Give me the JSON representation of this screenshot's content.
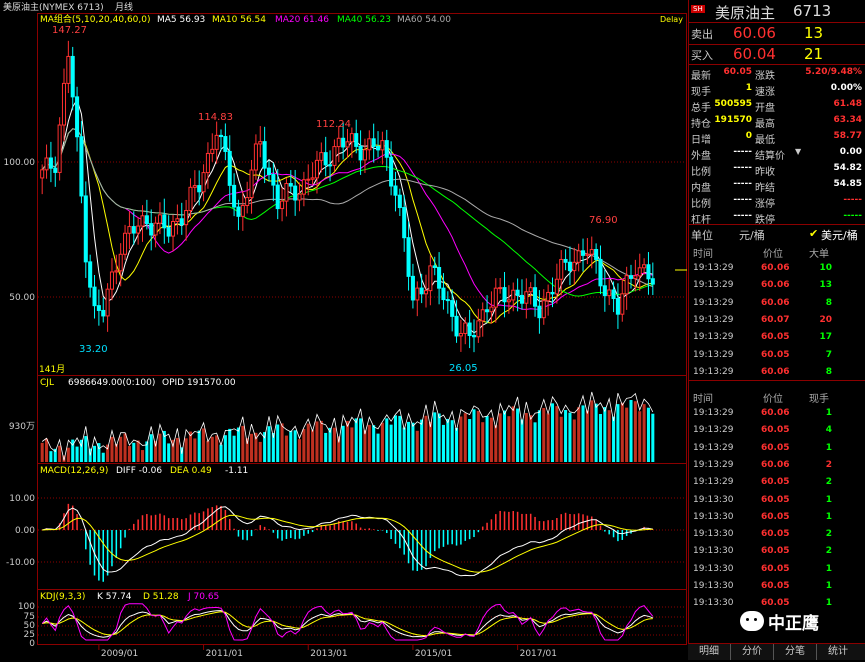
{
  "window": {
    "title": "美原油主(NYMEX 6713)",
    "period": "月线",
    "delay_label": "Delay"
  },
  "main_legend": {
    "group": "MA组合(5,10,20,40,60,0)",
    "items": [
      {
        "label": "MA5 56.93",
        "color": "#ffffff"
      },
      {
        "label": "MA10 56.54",
        "color": "#ffff00"
      },
      {
        "label": "MA20 61.46",
        "color": "#ff00ff"
      },
      {
        "label": "MA40 56.23",
        "color": "#00ff00"
      },
      {
        "label": "MA60 54.00",
        "color": "#aaaaaa"
      }
    ]
  },
  "annotations": {
    "high_2008": "147.27",
    "low_2009": "33.20",
    "high_2011a": "114.83",
    "high_2011b": "112.24",
    "low_2016": "26.05",
    "high_2018": "76.90",
    "bars_count": "141月"
  },
  "volume_legend": {
    "label": "CJL",
    "value": "6986649.00(0:100)",
    "opid": "OPID 191570.00"
  },
  "macd_legend": {
    "label": "MACD(12,26,9)",
    "diff": "DIFF -0.06",
    "dea": "DEA 0.49",
    "macd": "-1.11"
  },
  "kdj_legend": {
    "label": "KDJ(9,3,3)",
    "k": "K 57.74",
    "d": "D 51.28",
    "j": "J 70.65"
  },
  "chart_data": {
    "type": "candlestick",
    "price_axis": {
      "ticks": [
        "100.00",
        "50.00"
      ]
    },
    "volume_axis": {
      "ticks": [
        "930万"
      ]
    },
    "macd_axis": {
      "ticks": [
        "10.00",
        "0.00",
        "-10.00"
      ]
    },
    "kdj_axis": {
      "ticks": [
        "100",
        "75",
        "50",
        "25",
        "0"
      ]
    },
    "x_ticks": [
      "2009/01",
      "2011/01",
      "2013/01",
      "2015/01",
      "2017/01"
    ],
    "close_anchor_points": [
      [
        "2007/12",
        95
      ],
      [
        "2008/03",
        101
      ],
      [
        "2008/06",
        140
      ],
      [
        "2008/07",
        124
      ],
      [
        "2008/10",
        68
      ],
      [
        "2008/12",
        44
      ],
      [
        "2009/02",
        44
      ],
      [
        "2009/06",
        70
      ],
      [
        "2009/12",
        79
      ],
      [
        "2010/05",
        74
      ],
      [
        "2010/12",
        91
      ],
      [
        "2011/04",
        113
      ],
      [
        "2011/09",
        79
      ],
      [
        "2012/02",
        107
      ],
      [
        "2012/06",
        85
      ],
      [
        "2012/12",
        92
      ],
      [
        "2013/08",
        107
      ],
      [
        "2014/06",
        105
      ],
      [
        "2014/09",
        91
      ],
      [
        "2015/01",
        48
      ],
      [
        "2015/05",
        60
      ],
      [
        "2015/12",
        37
      ],
      [
        "2016/02",
        34
      ],
      [
        "2016/06",
        48
      ],
      [
        "2017/01",
        52
      ],
      [
        "2017/06",
        46
      ],
      [
        "2018/01",
        64
      ],
      [
        "2018/05",
        67
      ],
      [
        "2018/12",
        45
      ],
      [
        "2019/04",
        63
      ],
      [
        "2019/08",
        55
      ]
    ]
  },
  "quote": {
    "name": "美原油主",
    "code": "6713",
    "badge": "SH",
    "ask_label": "卖出",
    "ask_price": "60.06",
    "ask_vol": "13",
    "bid_label": "买入",
    "bid_price": "60.04",
    "bid_vol": "21",
    "stats_left": [
      {
        "label": "最新",
        "value": "60.05",
        "cls": "red"
      },
      {
        "label": "现手",
        "value": "1",
        "cls": "yel"
      },
      {
        "label": "总手",
        "value": "500595",
        "cls": "yel"
      },
      {
        "label": "持仓",
        "value": "191570",
        "cls": "yel"
      },
      {
        "label": "日增",
        "value": "0",
        "cls": "yel"
      },
      {
        "label": "外盘",
        "value": "-----",
        "cls": "wht"
      },
      {
        "label": "比例",
        "value": "-----",
        "cls": "wht"
      },
      {
        "label": "内盘",
        "value": "-----",
        "cls": "wht"
      },
      {
        "label": "比例",
        "value": "-----",
        "cls": "wht"
      },
      {
        "label": "杠杆",
        "value": "-----",
        "cls": "wht"
      }
    ],
    "stats_right": [
      {
        "label": "涨跌",
        "value": "5.20/9.48%",
        "cls": "red"
      },
      {
        "label": "速涨",
        "value": "0.00%",
        "cls": "wht"
      },
      {
        "label": "开盘",
        "value": "61.48",
        "cls": "red"
      },
      {
        "label": "最高",
        "value": "63.34",
        "cls": "red"
      },
      {
        "label": "最低",
        "value": "58.77",
        "cls": "red"
      },
      {
        "label": "结算价",
        "value": "0.00",
        "cls": "wht"
      },
      {
        "label": "昨收",
        "value": "54.82",
        "cls": "wht"
      },
      {
        "label": "昨结",
        "value": "54.85",
        "cls": "wht"
      },
      {
        "label": "涨停",
        "value": "-----",
        "cls": "red"
      },
      {
        "label": "跌停",
        "value": "-----",
        "cls": "grn"
      }
    ],
    "unit_label": "单位",
    "unit_a": "元/桶",
    "unit_b": "美元/桶"
  },
  "big_trades": {
    "headers": [
      "时间",
      "价位",
      "大单"
    ],
    "rows": [
      [
        "19:13:29",
        "60.06",
        "10",
        "grn"
      ],
      [
        "19:13:29",
        "60.06",
        "13",
        "grn"
      ],
      [
        "19:13:29",
        "60.06",
        "8",
        "grn"
      ],
      [
        "19:13:29",
        "60.07",
        "20",
        "red"
      ],
      [
        "19:13:29",
        "60.05",
        "17",
        "grn"
      ],
      [
        "19:13:29",
        "60.05",
        "7",
        "grn"
      ],
      [
        "19:13:29",
        "60.06",
        "8",
        "grn"
      ]
    ]
  },
  "ticks": {
    "headers": [
      "时间",
      "价位",
      "现手"
    ],
    "rows": [
      [
        "19:13:29",
        "60.06",
        "1",
        "grn"
      ],
      [
        "19:13:29",
        "60.05",
        "4",
        "grn"
      ],
      [
        "19:13:29",
        "60.05",
        "1",
        "grn"
      ],
      [
        "19:13:29",
        "60.06",
        "2",
        "red"
      ],
      [
        "19:13:29",
        "60.05",
        "2",
        "grn"
      ],
      [
        "19:13:30",
        "60.05",
        "1",
        "grn"
      ],
      [
        "19:13:30",
        "60.05",
        "1",
        "grn"
      ],
      [
        "19:13:30",
        "60.05",
        "2",
        "grn"
      ],
      [
        "19:13:30",
        "60.05",
        "2",
        "grn"
      ],
      [
        "19:13:30",
        "60.05",
        "1",
        "grn"
      ],
      [
        "19:13:30",
        "60.05",
        "1",
        "grn"
      ],
      [
        "19:13:30",
        "60.05",
        "1",
        "grn"
      ]
    ]
  },
  "tabs": [
    "明细",
    "分价",
    "分笔",
    "统计"
  ],
  "watermark": "中正鹰"
}
